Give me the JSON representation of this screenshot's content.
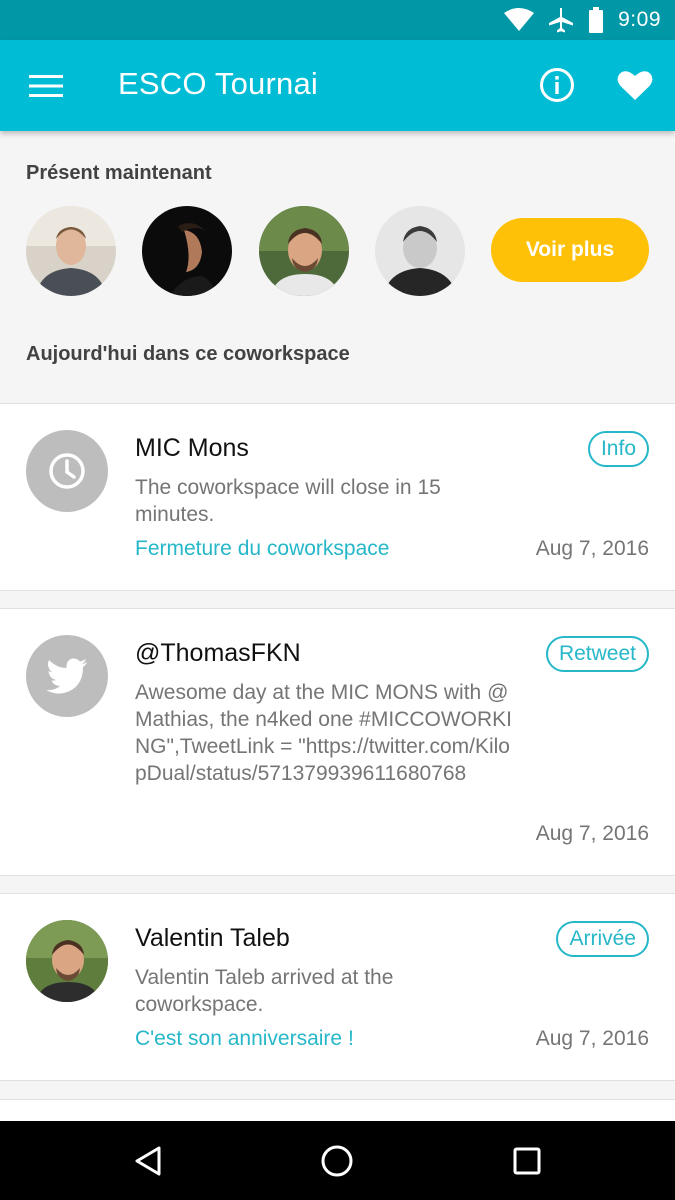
{
  "status_bar": {
    "time": "9:09",
    "icons": [
      "wifi-icon",
      "airplane-icon",
      "battery-icon"
    ]
  },
  "app_bar": {
    "title": "ESCO Tournai",
    "icons": [
      "menu-icon",
      "info-icon",
      "heart-icon"
    ],
    "color": "#00bcd4"
  },
  "present": {
    "title": "Présent maintenant",
    "button_label": "Voir plus",
    "button_color": "#ffc107"
  },
  "today": {
    "title": "Aujourd'hui dans ce coworkspace"
  },
  "feed": [
    {
      "icon": "clock-icon",
      "title": "MIC Mons",
      "text": "The coworkspace will close in 15 minutes.",
      "link": "Fermeture du coworkspace",
      "date": "Aug 7, 2016",
      "tag": "Info"
    },
    {
      "icon": "twitter-icon",
      "title": "@ThomasFKN",
      "text": "Awesome day at the MIC MONS with @Mathias, the n4ked one #MICCOWORKING\",TweetLink = \"https://twitter.com/KilopDual/status/571379939611680768",
      "date": "Aug 7, 2016",
      "tag": "Retweet"
    },
    {
      "icon": "avatar",
      "title": "Valentin Taleb",
      "text": "Valentin Taleb arrived at the coworkspace.",
      "link": "C'est son anniversaire !",
      "date": "Aug 7, 2016",
      "tag": "Arrivée"
    }
  ],
  "nav_bar": {
    "icons": [
      "back-icon",
      "home-icon",
      "recents-icon"
    ]
  },
  "colors": {
    "accent": "#26b7c9",
    "status_bar": "#0097a7"
  }
}
